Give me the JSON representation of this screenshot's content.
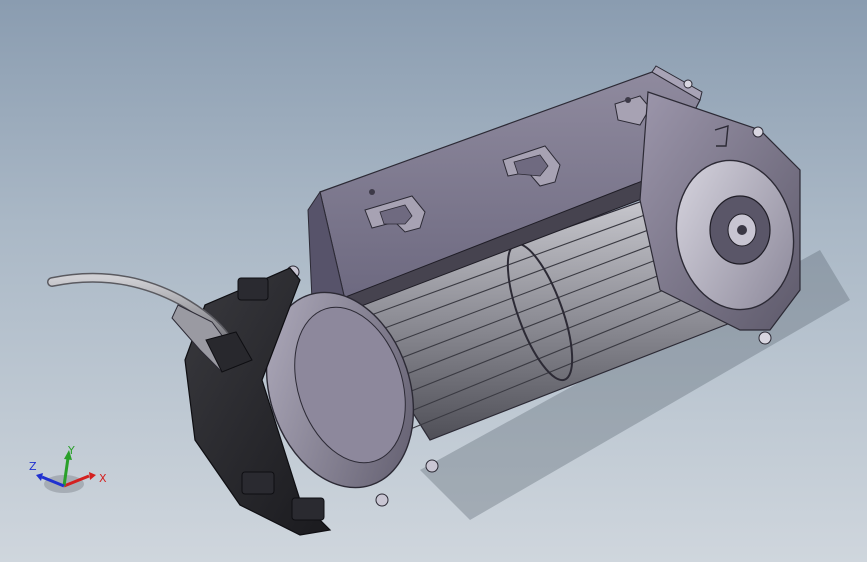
{
  "view": {
    "background_top": "#8a9cb0",
    "background_bottom": "#cfd6dd",
    "model_description": ""
  },
  "triad": {
    "x_label": "X",
    "y_label": "Y",
    "z_label": "Z",
    "x_color": "#d42020",
    "y_color": "#2aa02a",
    "z_color": "#2030d0"
  }
}
